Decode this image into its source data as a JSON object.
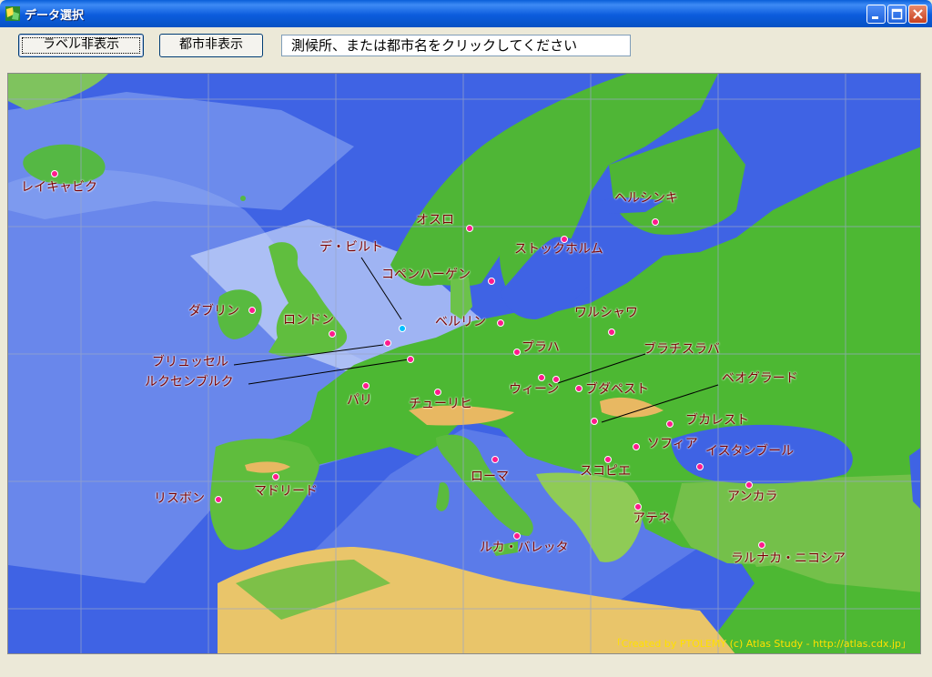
{
  "window": {
    "title": "データ選択"
  },
  "toolbar": {
    "label_toggle": "ラベル非表示",
    "city_toggle": "都市非表示",
    "status": "測候所、または都市名をクリックしてください"
  },
  "map": {
    "credit": "「Created by PTOLEMY (c) Atlas Study - http://atlas.cdx.jp」",
    "cities": [
      {
        "label": "レイキャビク"
      },
      {
        "label": "オスロ"
      },
      {
        "label": "ヘルシンキ"
      },
      {
        "label": "ストックホルム"
      },
      {
        "label": "デ・ビルト"
      },
      {
        "label": "コペンハーゲン"
      },
      {
        "label": "ダブリン"
      },
      {
        "label": "ロンドン"
      },
      {
        "label": "ベルリン"
      },
      {
        "label": "ワルシャワ"
      },
      {
        "label": "ブリュッセル"
      },
      {
        "label": "ルクセンブルク"
      },
      {
        "label": "プラハ"
      },
      {
        "label": "ブラチスラバ"
      },
      {
        "label": "パリ"
      },
      {
        "label": "チューリヒ"
      },
      {
        "label": "ウィーン"
      },
      {
        "label": "ブダペスト"
      },
      {
        "label": "ベオグラード"
      },
      {
        "label": "ブカレスト"
      },
      {
        "label": "ソフィア"
      },
      {
        "label": "イスタンブール"
      },
      {
        "label": "ローマ"
      },
      {
        "label": "スコピエ"
      },
      {
        "label": "マドリード"
      },
      {
        "label": "リスボン"
      },
      {
        "label": "アンカラ"
      },
      {
        "label": "アテネ"
      },
      {
        "label": "ルカ・バレッタ"
      },
      {
        "label": "ラルナカ・ニコシア"
      }
    ]
  },
  "colors": {
    "sea": "#3F63E4",
    "land": "#4DB833",
    "label": "#7A0000",
    "city_marker": "#FF1A8C"
  }
}
